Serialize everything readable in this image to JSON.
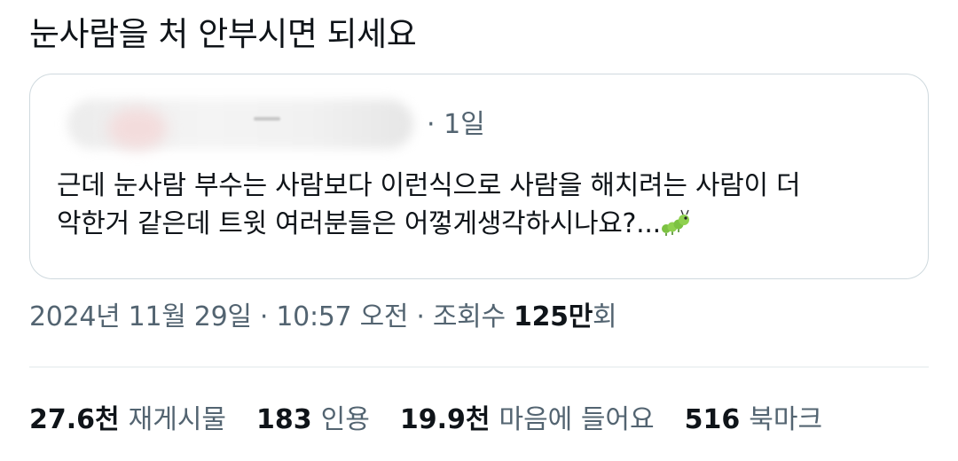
{
  "post": {
    "text": "눈사람을 처 안부시면 되세요"
  },
  "quoted_post": {
    "time_ago": "· 1일",
    "body_line_1": "근데 눈사람 부수는 사람보다 이런식으로 사람을 해치려는 사람이 더",
    "body_line_2": "악한거 같은데 트윗 여러분들은 어껗게생각하시나요?...",
    "emoji_icon": "caterpillar-icon"
  },
  "meta": {
    "timestamp": "2024년 11월 29일 · 10:57 오전 · 조회수 ",
    "views_count": "125만",
    "views_suffix": "회"
  },
  "stats": {
    "reposts_count": "27.6천",
    "reposts_label": "재게시물",
    "quotes_count": "183",
    "quotes_label": "인용",
    "likes_count": "19.9천",
    "likes_label": "마음에 들어요",
    "bookmarks_count": "516",
    "bookmarks_label": "북마크"
  },
  "colors": {
    "text_primary": "#0f1419",
    "text_secondary": "#536471",
    "border": "#cfd9de"
  }
}
